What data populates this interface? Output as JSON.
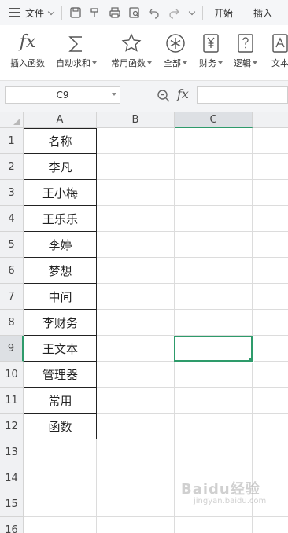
{
  "menu": {
    "file_label": "文件",
    "tabs": [
      "开始",
      "插入"
    ]
  },
  "ribbon": {
    "items": [
      {
        "label": "插入函数",
        "icon": "fx-icon"
      },
      {
        "label": "自动求和",
        "icon": "sigma-icon"
      },
      {
        "label": "常用函数",
        "icon": "star-icon"
      },
      {
        "label": "全部",
        "icon": "all-functions-icon"
      },
      {
        "label": "财务",
        "icon": "yen-icon"
      },
      {
        "label": "逻辑",
        "icon": "logic-icon"
      },
      {
        "label": "文本",
        "icon": "text-icon"
      }
    ]
  },
  "formula_bar": {
    "cell_ref": "C9",
    "fx_label": "fx",
    "formula": ""
  },
  "sheet": {
    "columns": [
      "A",
      "B",
      "C"
    ],
    "selected_column": "C",
    "rows": [
      "1",
      "2",
      "3",
      "4",
      "5",
      "6",
      "7",
      "8",
      "9",
      "10",
      "11",
      "12",
      "13",
      "14",
      "15",
      "16"
    ],
    "selected_row": "9",
    "column_a_values": [
      "名称",
      "李凡",
      "王小梅",
      "王乐乐",
      "李婷",
      "梦想",
      "中间",
      "李财务",
      "王文本",
      "管理器",
      "常用",
      "函数"
    ],
    "active_cell": "C9"
  },
  "watermark": {
    "text": "Baidu经验",
    "sub": "jingyan.baidu.com"
  },
  "colors": {
    "accent": "#2e9b6b",
    "header_bg": "#f0f1f3"
  }
}
